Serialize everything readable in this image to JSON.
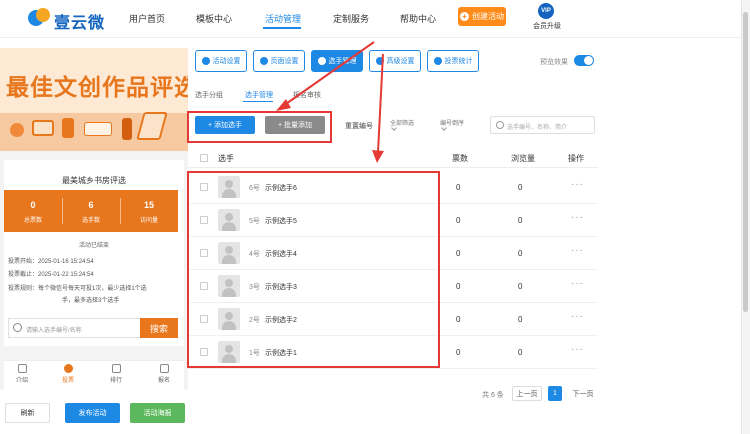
{
  "header": {
    "logo_text": "壹云微",
    "nav": [
      "用户首页",
      "模板中心",
      "活动管理",
      "定制服务",
      "帮助中心"
    ],
    "active_nav": "活动管理",
    "create_label": "创建活动",
    "vip_badge": "VIP",
    "vip_label": "会员升级"
  },
  "preview": {
    "banner_title": "最佳文创作品评选",
    "card_title": "最美城乡书房评选",
    "stats": [
      {
        "value": "0",
        "label": "总票数"
      },
      {
        "value": "6",
        "label": "选手数"
      },
      {
        "value": "15",
        "label": "访问量"
      }
    ],
    "ended_text": "活动已结束",
    "info": [
      "投票开始：2025-01-16 15:24:54",
      "投票截止：2025-01-22 15:24:54",
      "投票规则：每个微信号每天可投1次，最少选择1个选",
      "手，最多选择3个选手"
    ],
    "search_placeholder": "请输入选手编号/名称",
    "search_button": "搜索",
    "tabs": [
      "介绍",
      "投票",
      "排行",
      "报名"
    ],
    "active_tab": "投票"
  },
  "footer_buttons": {
    "refresh": "刷新",
    "publish": "发布活动",
    "poster": "活动海报"
  },
  "toolbar": {
    "buttons": [
      "活动设置",
      "页面设置",
      "选手管理",
      "高级设置",
      "投票统计"
    ],
    "active": "选手管理",
    "preview_label": "预览效果",
    "preview_toggle_on": true
  },
  "subtabs": [
    "选手分组",
    "选手管理",
    "报名审核"
  ],
  "active_subtab": "选手管理",
  "actions": {
    "add": "+ 添加选手",
    "batch": "+ 批量添加",
    "reset_no": "重置编号",
    "filter_all": "全部筛选",
    "order": "编号倒序",
    "search_placeholder": "选手编号、名称、简介"
  },
  "table": {
    "headers": [
      "选手",
      "票数",
      "浏览量",
      "操作"
    ],
    "rows": [
      {
        "no": "6号",
        "name": "示例选手6",
        "votes": "0",
        "views": "0",
        "action": "···"
      },
      {
        "no": "5号",
        "name": "示例选手5",
        "votes": "0",
        "views": "0",
        "action": "···"
      },
      {
        "no": "4号",
        "name": "示例选手4",
        "votes": "0",
        "views": "0",
        "action": "···"
      },
      {
        "no": "3号",
        "name": "示例选手3",
        "votes": "0",
        "views": "0",
        "action": "···"
      },
      {
        "no": "2号",
        "name": "示例选手2",
        "votes": "0",
        "views": "0",
        "action": "···"
      },
      {
        "no": "1号",
        "name": "示例选手1",
        "votes": "0",
        "views": "0",
        "action": "···"
      }
    ]
  },
  "pagination": {
    "total": "共 6 条",
    "prev": "上一页",
    "current": "1",
    "next": "下一页"
  },
  "colors": {
    "primary": "#1e88e5",
    "accent_orange": "#e8761c",
    "highlight_red": "#e53935",
    "success_green": "#5cb85c"
  }
}
